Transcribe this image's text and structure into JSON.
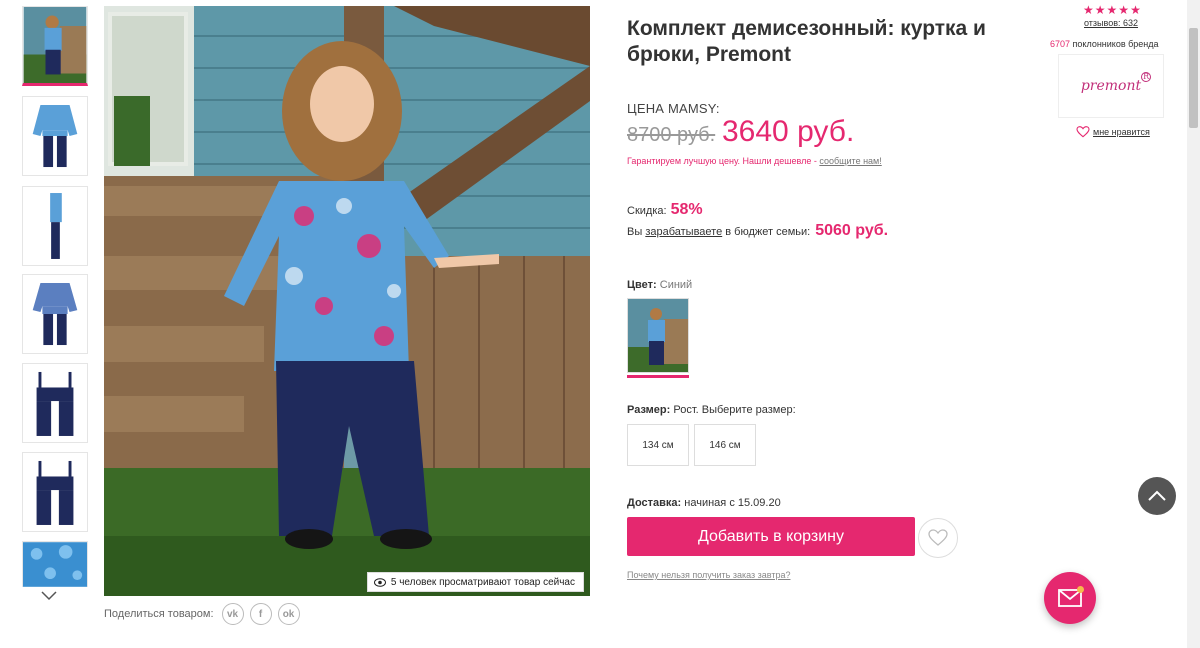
{
  "product": {
    "title": "Комплект демисезонный: куртка и брюки, Premont",
    "price_label": "ЦЕНА MAMSY:",
    "old_price": "8700 руб.",
    "new_price": "3640 руб.",
    "guarantee_text": "Гарантируем лучшую цену. Нашли дешевле - ",
    "guarantee_link": "сообщите нам!",
    "discount_label": "Скидка:",
    "discount_value": "58%",
    "earn_prefix": "Вы",
    "earn_link": "зарабатываете",
    "earn_suffix": "в бюджет семьи:",
    "earn_value": "5060 руб.",
    "color_label": "Цвет:",
    "color_value": "Синий",
    "size_label": "Размер:",
    "size_hint": "Рост. Выберите размер:",
    "sizes": [
      "134 см",
      "146 см"
    ],
    "delivery_label": "Доставка:",
    "delivery_value": "начиная с 15.09.20",
    "add_to_cart": "Добавить в корзину",
    "why_link": "Почему нельзя получить заказ завтра?"
  },
  "gallery": {
    "viewers_text": "5 человек просматривают товар сейчас",
    "share_label": "Поделиться товаром:",
    "socials": [
      "vk",
      "f",
      "ok"
    ]
  },
  "brand": {
    "stars": [
      "★",
      "★",
      "★",
      "★",
      "★"
    ],
    "reviews": "отзывов: 632",
    "fans_count": "6707",
    "fans_text": "поклонников бренда",
    "logo_text": "premont",
    "like_text": "мне нравится"
  },
  "colors": {
    "accent": "#e5286f",
    "jacket": "#5aa0d8",
    "pants": "#1f2a5c"
  }
}
